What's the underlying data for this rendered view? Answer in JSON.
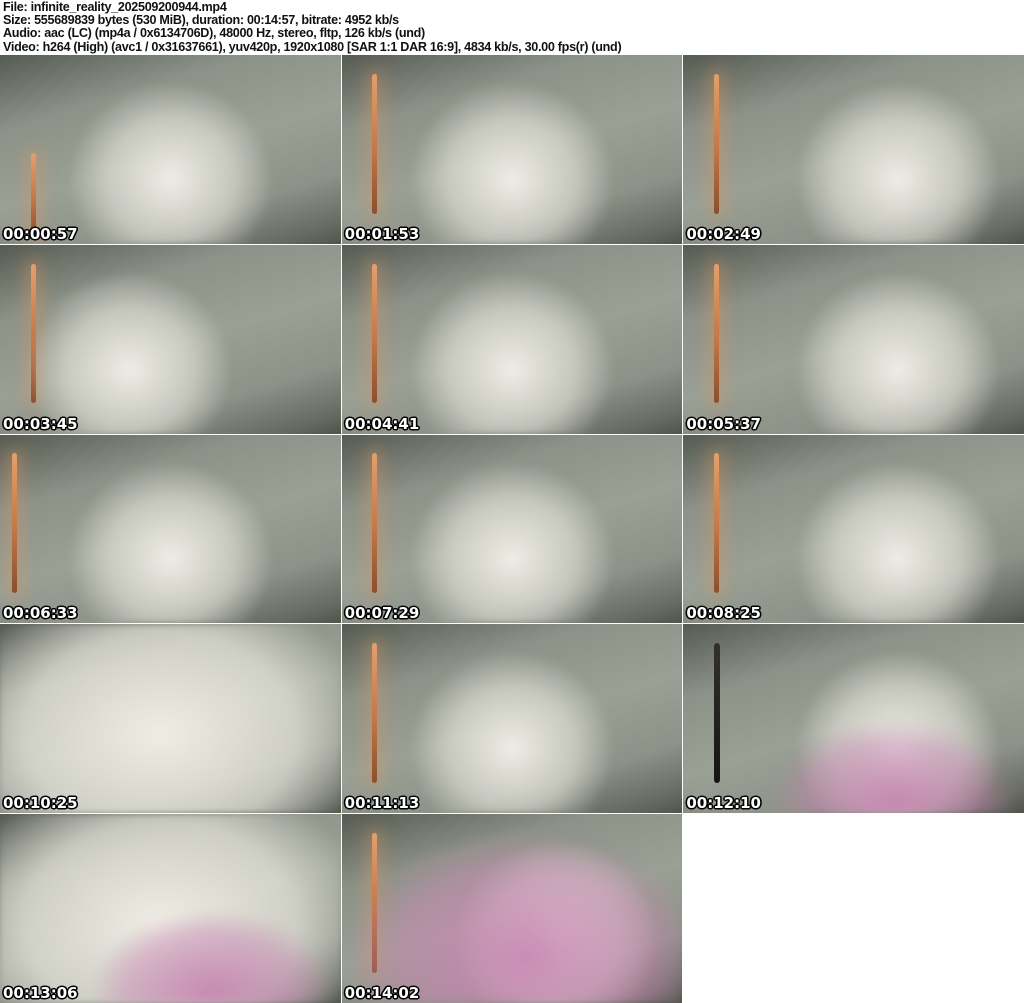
{
  "header": {
    "lines": [
      "File: infinite_reality_202509200944.mp4",
      "Size: 555689839 bytes (530 MiB), duration: 00:14:57, bitrate: 4952 kb/s",
      "Audio: aac (LC) (mp4a / 0x6134706D), 48000 Hz, stereo, fltp, 126 kb/s (und)",
      "Video: h264 (High) (avc1 / 0x31637661), yuv420p, 1920x1080 [SAR 1:1 DAR 16:9], 4834 kb/s, 30.00 fps(r) (und)"
    ]
  },
  "grid": {
    "columns": 3,
    "rows": 5,
    "thumbnail_count": 14
  },
  "thumbnails": [
    {
      "timestamp": "00:00:57",
      "variant": "v-lamp-low v-sub-c"
    },
    {
      "timestamp": "00:01:53",
      "variant": "v-sub-c"
    },
    {
      "timestamp": "00:02:49",
      "variant": "v-sub-r"
    },
    {
      "timestamp": "00:03:45",
      "variant": "v-sub-l"
    },
    {
      "timestamp": "00:04:41",
      "variant": "v-sub-c"
    },
    {
      "timestamp": "00:05:37",
      "variant": "v-sub-r"
    },
    {
      "timestamp": "00:06:33",
      "variant": "v-lamp-edge v-sub-c"
    },
    {
      "timestamp": "00:07:29",
      "variant": "v-sub-c"
    },
    {
      "timestamp": "00:08:25",
      "variant": "v-sub-r"
    },
    {
      "timestamp": "00:10:25",
      "variant": "v-no-lamp v-sub-big"
    },
    {
      "timestamp": "00:11:13",
      "variant": "v-sub-c"
    },
    {
      "timestamp": "00:12:10",
      "variant": "v-lamp-dark v-sub-r v-pink"
    },
    {
      "timestamp": "00:13:06",
      "variant": "v-no-lamp v-sub-big v-pink"
    },
    {
      "timestamp": "00:14:02",
      "variant": "v-sub-r v-pink-big"
    }
  ],
  "palette": {
    "page_bg": "#ffffff",
    "header_text": "#111111",
    "wall": "#8d9288",
    "wall_light": "#9aa095",
    "wall_dark": "#565b52",
    "lamp": "#c27747",
    "lamp_hi": "#e2a06b",
    "pink": "#c683b1",
    "timestamp_text": "#ffffff",
    "timestamp_outline": "#000000"
  }
}
